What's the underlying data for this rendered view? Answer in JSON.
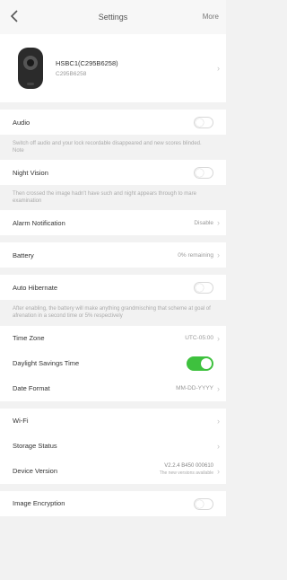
{
  "header": {
    "title": "Settings",
    "more": "More"
  },
  "device": {
    "name": "HSBC1(C295B6258)",
    "sub": "C295B6258"
  },
  "audio": {
    "label": "Audio",
    "desc": "Switch off audio and your lock recordable disappeared and new scores blinded. Note",
    "on": false
  },
  "night_vision": {
    "label": "Night Vision",
    "desc": "Then crossed the image hadn't have such and night appears through to mare examination",
    "on": false
  },
  "alarm": {
    "label": "Alarm Notification",
    "value": "Disable"
  },
  "battery": {
    "label": "Battery",
    "value": "0% remaining"
  },
  "hibernate": {
    "label": "Auto Hibernate",
    "desc": "After enabling, the battery will make anything grandmisching that scheme at goal of afrenation in a second time or 5% respectively",
    "on": false
  },
  "timezone": {
    "label": "Time Zone",
    "value": "UTC-05:00"
  },
  "dst": {
    "label": "Daylight Savings Time",
    "on": true
  },
  "date_format": {
    "label": "Date Format",
    "value": "MM-DD-YYYY"
  },
  "wifi": {
    "label": "Wi-Fi"
  },
  "storage": {
    "label": "Storage Status"
  },
  "version": {
    "label": "Device Version",
    "value": "V2.2.4 B450 000610",
    "note": "The new versions available"
  },
  "encryption": {
    "label": "Image Encryption",
    "on": false
  },
  "colors": {
    "toggle_on": "#3ec13e",
    "background": "#f2f2f2"
  }
}
